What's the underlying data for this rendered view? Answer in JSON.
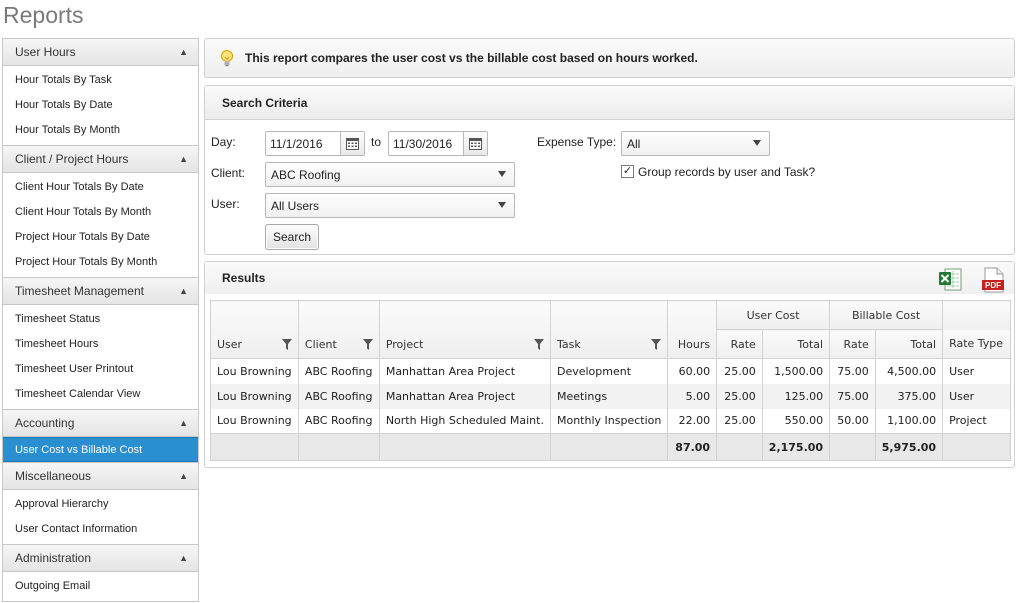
{
  "page": {
    "title": "Reports"
  },
  "sidebar": {
    "sections": [
      {
        "label": "User Hours",
        "items": [
          "Hour Totals By Task",
          "Hour Totals By Date",
          "Hour Totals By Month"
        ]
      },
      {
        "label": "Client / Project Hours",
        "items": [
          "Client Hour Totals By Date",
          "Client Hour Totals By Month",
          "Project Hour Totals By Date",
          "Project Hour Totals By Month"
        ]
      },
      {
        "label": "Timesheet Management",
        "items": [
          "Timesheet Status",
          "Timesheet Hours",
          "Timesheet User Printout",
          "Timesheet Calendar View"
        ]
      },
      {
        "label": "Accounting",
        "items": [
          "User Cost vs Billable Cost"
        ]
      },
      {
        "label": "Miscellaneous",
        "items": [
          "Approval Hierarchy",
          "User Contact Information"
        ]
      },
      {
        "label": "Administration",
        "items": [
          "Outgoing Email"
        ]
      }
    ],
    "caret": "▲",
    "active_item": "User Cost vs Billable Cost"
  },
  "info": {
    "icon": "lightbulb-icon",
    "text": "This report compares the user cost vs the billable cost based on hours worked."
  },
  "criteria": {
    "title": "Search Criteria",
    "day_label": "Day:",
    "day_from": "11/1/2016",
    "to_label": "to",
    "day_to": "11/30/2016",
    "client_label": "Client:",
    "client_value": "ABC Roofing",
    "user_label": "User:",
    "user_value": "All Users",
    "expense_label": "Expense Type:",
    "expense_value": "All",
    "group_checked": true,
    "group_label": "Group records by user and Task?",
    "search_button": "Search"
  },
  "results": {
    "title": "Results",
    "export_excel_icon": "excel-icon",
    "export_pdf_icon": "pdf-icon",
    "group_headers": {
      "user_cost": "User Cost",
      "billable_cost": "Billable Cost"
    },
    "columns": {
      "user": "User",
      "client": "Client",
      "project": "Project",
      "task": "Task",
      "hours": "Hours",
      "uc_rate": "Rate",
      "uc_total": "Total",
      "bc_rate": "Rate",
      "bc_total": "Total",
      "rate_type": "Rate Type"
    },
    "rows": [
      [
        "Lou Browning",
        "ABC Roofing",
        "Manhattan Area Project",
        "Development",
        "60.00",
        "25.00",
        "1,500.00",
        "75.00",
        "4,500.00",
        "User"
      ],
      [
        "Lou Browning",
        "ABC Roofing",
        "Manhattan Area Project",
        "Meetings",
        "5.00",
        "25.00",
        "125.00",
        "75.00",
        "375.00",
        "User"
      ],
      [
        "Lou Browning",
        "ABC Roofing",
        "North High Scheduled Maint.",
        "Monthly Inspection",
        "22.00",
        "25.00",
        "550.00",
        "50.00",
        "1,100.00",
        "Project"
      ]
    ],
    "totals": {
      "hours": "87.00",
      "uc_total": "2,175.00",
      "bc_total": "5,975.00"
    }
  }
}
